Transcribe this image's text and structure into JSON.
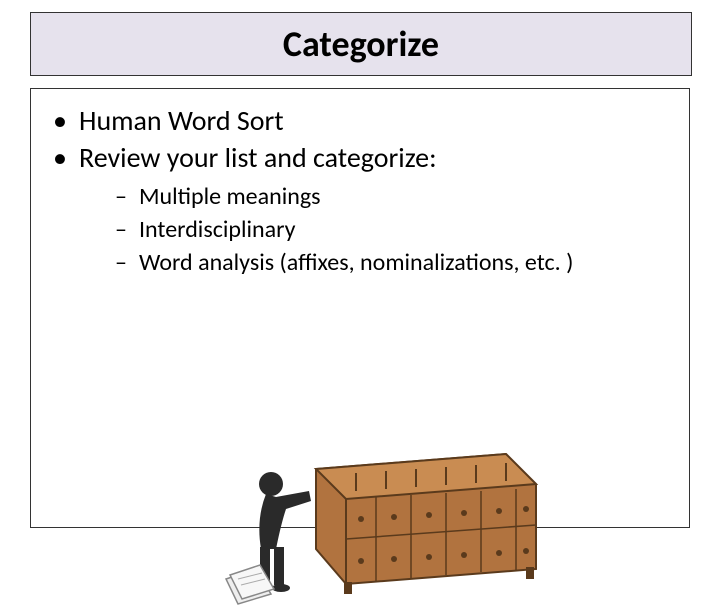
{
  "title": "Categorize",
  "bullets": {
    "b1": "Human Word Sort",
    "b2": "Review your list and categorize:",
    "sub1": "Multiple meanings",
    "sub2": "Interdisciplinary",
    "sub3": "Word analysis (affixes, nominalizations, etc. )"
  }
}
